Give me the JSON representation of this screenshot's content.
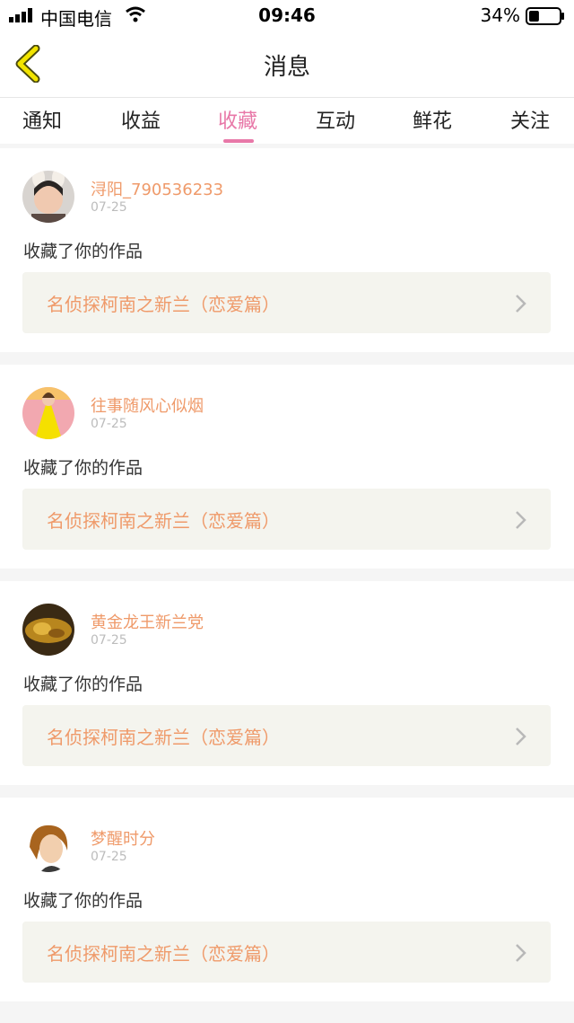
{
  "status_bar": {
    "carrier": "中国电信",
    "time": "09:46",
    "battery_percent": "34%",
    "battery_level": 0.34
  },
  "nav": {
    "title": "消息"
  },
  "tabs": [
    "通知",
    "收益",
    "收藏",
    "互动",
    "鲜花",
    "关注"
  ],
  "active_tab_index": 2,
  "accent_color": "#e878a8",
  "name_color": "#ef9a6a",
  "messages": [
    {
      "user": "浔阳_790536233",
      "date": "07-25",
      "action": "收藏了你的作品",
      "work": "名侦探柯南之新兰（恋爱篇）"
    },
    {
      "user": "往事随风心似烟",
      "date": "07-25",
      "action": "收藏了你的作品",
      "work": "名侦探柯南之新兰（恋爱篇）"
    },
    {
      "user": "黄金龙王新兰党",
      "date": "07-25",
      "action": "收藏了你的作品",
      "work": "名侦探柯南之新兰（恋爱篇）"
    },
    {
      "user": "梦醒时分",
      "date": "07-25",
      "action": "收藏了你的作品",
      "work": "名侦探柯南之新兰（恋爱篇）"
    }
  ]
}
